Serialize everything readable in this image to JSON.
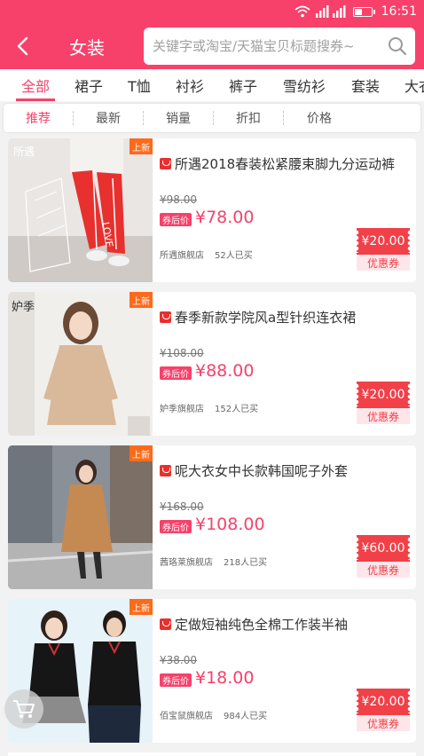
{
  "status_bar": {
    "time": "16:51",
    "wifi_icon": "wifi-icon",
    "signal_icon": "signal-icon",
    "battery_icon": "battery-icon"
  },
  "header": {
    "back_icon": "chevron-left-icon",
    "title": "女装",
    "search_placeholder": "关键字或淘宝/天猫宝贝标题搜券~",
    "search_icon": "search-icon"
  },
  "colors": {
    "accent": "#f7416a",
    "badge": "#ff6a1a",
    "coupon": "#f24048"
  },
  "tabs": [
    {
      "label": "全部",
      "active": true
    },
    {
      "label": "裙子",
      "active": false
    },
    {
      "label": "T恤",
      "active": false
    },
    {
      "label": "衬衫",
      "active": false
    },
    {
      "label": "裤子",
      "active": false
    },
    {
      "label": "雪纺衫",
      "active": false
    },
    {
      "label": "套装",
      "active": false
    },
    {
      "label": "大衣",
      "active": false
    }
  ],
  "sort": [
    {
      "label": "推荐",
      "active": true
    },
    {
      "label": "最新",
      "active": false
    },
    {
      "label": "销量",
      "active": false
    },
    {
      "label": "折扣",
      "active": false
    },
    {
      "label": "价格",
      "active": false
    }
  ],
  "products": [
    {
      "title": "所遇2018春装松紧腰束脚九分运动裤",
      "badge": "上新",
      "thumb_text": "所遇",
      "original_price": "¥98.00",
      "after_label": "券后价",
      "price": "¥78.00",
      "shop": "所遇旗舰店",
      "sold": "52人已买",
      "coupon_value": "¥20.00",
      "coupon_label": "优惠券"
    },
    {
      "title": "春季新款学院风a型针织连衣裙",
      "badge": "上新",
      "thumb_text": "妒季",
      "original_price": "¥108.00",
      "after_label": "券后价",
      "price": "¥88.00",
      "shop": "妒季旗舰店",
      "sold": "152人已买",
      "coupon_value": "¥20.00",
      "coupon_label": "优惠券"
    },
    {
      "title": "呢大衣女中长款韩国呢子外套",
      "badge": "上新",
      "thumb_text": "",
      "original_price": "¥168.00",
      "after_label": "券后价",
      "price": "¥108.00",
      "shop": "茜珞莱旗舰店",
      "sold": "218人已买",
      "coupon_value": "¥60.00",
      "coupon_label": "优惠券"
    },
    {
      "title": "定做短袖纯色全棉工作装半袖",
      "badge": "上新",
      "thumb_text": "",
      "original_price": "¥38.00",
      "after_label": "券后价",
      "price": "¥18.00",
      "shop": "佰宝鼠旗舰店",
      "sold": "984人已买",
      "coupon_value": "¥20.00",
      "coupon_label": "优惠券"
    }
  ],
  "cart_icon": "shopping-cart-icon"
}
